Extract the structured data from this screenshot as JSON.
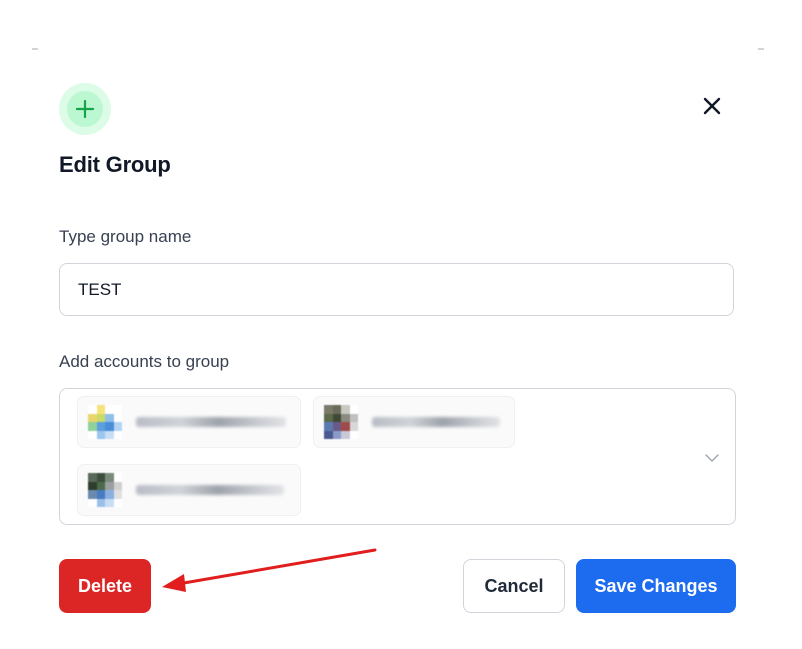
{
  "dialog": {
    "title": "Edit Group",
    "header_icon": "plus-icon",
    "close_icon": "close-icon"
  },
  "form": {
    "name_label": "Type group name",
    "name_value": "TEST",
    "accounts_label": "Add accounts to group",
    "accounts_placeholder_icon": "chevron-down-icon",
    "selected_accounts": [
      {
        "name": "",
        "avatar": "blurred-avatar"
      },
      {
        "name": "",
        "avatar": "blurred-avatar"
      },
      {
        "name": "",
        "avatar": "blurred-avatar"
      }
    ]
  },
  "actions": {
    "delete_label": "Delete",
    "cancel_label": "Cancel",
    "save_label": "Save Changes"
  },
  "annotation": {
    "arrow_color": "#e11d1d"
  },
  "colors": {
    "accent_green": "#22c55e",
    "delete_red": "#dc2626",
    "primary_blue": "#1d6cf0"
  }
}
